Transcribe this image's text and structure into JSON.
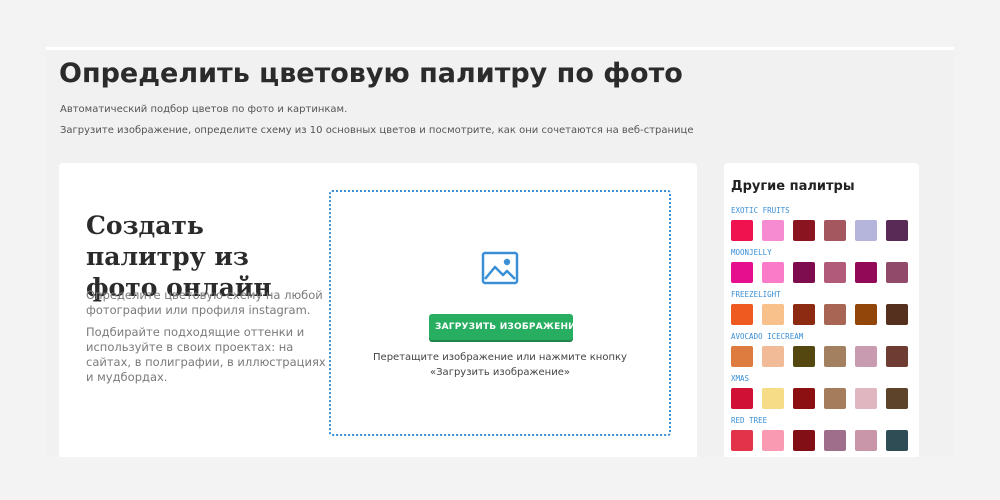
{
  "header": {
    "title": "Определить цветовую палитру по фото",
    "subtitle_1": "Автоматический подбор цветов по фото и картинкам.",
    "subtitle_2": "Загрузите изображение, определите схему из 10 основных цветов и посмотрите, как они сочетаются на веб-странице"
  },
  "main": {
    "heading": "Создать палитру из фото онлайн",
    "text_1": "Определите цветовую схему на любой фотографии или профиля instagram.",
    "text_2": "Подбирайте подходящие оттенки и используйте в своих проектах: на сайтах, в полиграфии, в иллюстрациях и мудбордах.",
    "upload_label": "Загрузить изображение",
    "drop_hint": "Перетащите изображение или нажмите кнопку «Загрузить изображение»",
    "icon": "image-icon",
    "accent_color": "#27ae60"
  },
  "sidebar": {
    "title": "Другие палитры",
    "palettes": [
      {
        "name": "exotic fruits",
        "colors": [
          "#f0114f",
          "#f78bd1",
          "#8a1521",
          "#a5575f",
          "#b5b4da",
          "#592a56"
        ]
      },
      {
        "name": "moonjelly",
        "colors": [
          "#e6108e",
          "#fa7cc8",
          "#7d0d4f",
          "#b15a7a",
          "#920a57",
          "#924a6a"
        ]
      },
      {
        "name": "freezelight",
        "colors": [
          "#ef5a20",
          "#f8c08a",
          "#8c2a12",
          "#a86554",
          "#93460a",
          "#56301f"
        ]
      },
      {
        "name": "avocado icecream",
        "colors": [
          "#dd7c3e",
          "#f1bb98",
          "#54470f",
          "#a28060",
          "#c99bb1",
          "#6f3c34"
        ]
      },
      {
        "name": "xmas",
        "colors": [
          "#d11036",
          "#f6dc86",
          "#8c0f12",
          "#a57d5d",
          "#e0b6c1",
          "#5d4329"
        ]
      },
      {
        "name": "red tree",
        "colors": [
          "#e3334a",
          "#f999b2",
          "#820f16",
          "#9e6e8a",
          "#c996a9",
          "#2f4d55"
        ]
      }
    ]
  }
}
